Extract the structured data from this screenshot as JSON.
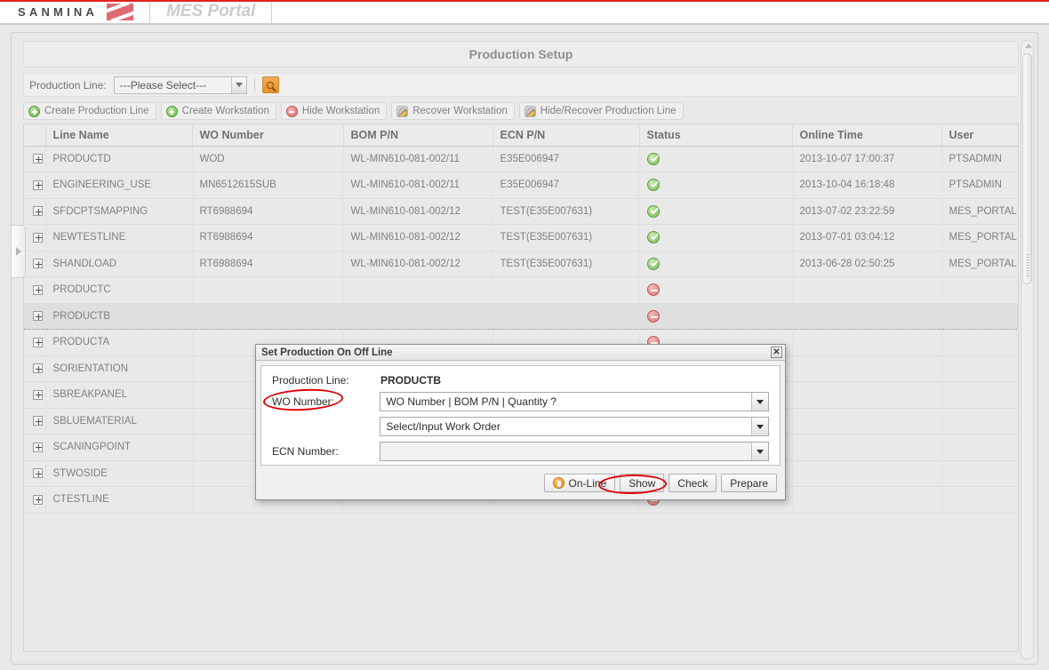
{
  "brand": {
    "company": "SANMINA",
    "product": "MES Portal",
    "logo_color": "#e06a72",
    "accent_red": "#e2231a"
  },
  "page": {
    "title": "Production Setup"
  },
  "filter_bar": {
    "production_line_label": "Production Line:",
    "production_line_value": "---Please Select---",
    "search_icon": "search-icon"
  },
  "actions": [
    {
      "label": "Create Production Line",
      "icon": "plus-circle-green-icon"
    },
    {
      "label": "Create Workstation",
      "icon": "plus-circle-green-icon"
    },
    {
      "label": "Hide Workstation",
      "icon": "minus-circle-red-icon"
    },
    {
      "label": "Recover Workstation",
      "icon": "gear-pencil-icon"
    },
    {
      "label": "Hide/Recover Production Line",
      "icon": "gear-pencil-icon"
    }
  ],
  "grid": {
    "columns": [
      "Line Name",
      "WO Number",
      "BOM P/N",
      "ECN P/N",
      "Status",
      "Online Time",
      "User"
    ],
    "rows": [
      {
        "line": "PRODUCTD",
        "wo": "WOD",
        "bom": "WL-MIN610-081-002/11",
        "ecn": "E35E006947",
        "status": "online",
        "time": "2013-10-07 17:00:37",
        "user": "PTSADMIN",
        "selected": false
      },
      {
        "line": "ENGINEERING_USE",
        "wo": "MN6512615SUB",
        "bom": "WL-MIN610-081-002/11",
        "ecn": "E35E006947",
        "status": "online",
        "time": "2013-10-04 16:18:48",
        "user": "PTSADMIN",
        "selected": false
      },
      {
        "line": "SFDCPTSMAPPING",
        "wo": "RT6988694",
        "bom": "WL-MIN610-081-002/12",
        "ecn": "TEST(E35E007631)",
        "status": "online",
        "time": "2013-07-02 23:22:59",
        "user": "MES_PORTAL",
        "selected": false
      },
      {
        "line": "NEWTESTLINE",
        "wo": "RT6988694",
        "bom": "WL-MIN610-081-002/12",
        "ecn": "TEST(E35E007631)",
        "status": "online",
        "time": "2013-07-01 03:04:12",
        "user": "MES_PORTAL",
        "selected": false
      },
      {
        "line": "SHANDLOAD",
        "wo": "RT6988694",
        "bom": "WL-MIN610-081-002/12",
        "ecn": "TEST(E35E007631)",
        "status": "online",
        "time": "2013-06-28 02:50:25",
        "user": "MES_PORTAL",
        "selected": false
      },
      {
        "line": "PRODUCTC",
        "wo": "",
        "bom": "",
        "ecn": "",
        "status": "offline",
        "time": "",
        "user": "",
        "selected": false
      },
      {
        "line": "PRODUCTB",
        "wo": "",
        "bom": "",
        "ecn": "",
        "status": "offline",
        "time": "",
        "user": "",
        "selected": true
      },
      {
        "line": "PRODUCTA",
        "wo": "",
        "bom": "",
        "ecn": "",
        "status": "offline",
        "time": "",
        "user": "",
        "selected": false
      },
      {
        "line": "SORIENTATION",
        "wo": "",
        "bom": "",
        "ecn": "",
        "status": "offline",
        "time": "",
        "user": "",
        "selected": false
      },
      {
        "line": "SBREAKPANEL",
        "wo": "",
        "bom": "",
        "ecn": "",
        "status": "offline",
        "time": "",
        "user": "",
        "selected": false
      },
      {
        "line": "SBLUEMATERIAL",
        "wo": "",
        "bom": "",
        "ecn": "",
        "status": "offline",
        "time": "",
        "user": "",
        "selected": false
      },
      {
        "line": "SCANINGPOINT",
        "wo": "",
        "bom": "",
        "ecn": "",
        "status": "offline",
        "time": "",
        "user": "",
        "selected": false
      },
      {
        "line": "STWOSIDE",
        "wo": "",
        "bom": "",
        "ecn": "",
        "status": "offline",
        "time": "",
        "user": "",
        "selected": false
      },
      {
        "line": "CTESTLINE",
        "wo": "",
        "bom": "",
        "ecn": "",
        "status": "offline",
        "time": "",
        "user": "",
        "selected": false
      }
    ]
  },
  "dialog": {
    "title": "Set Production On Off Line",
    "close_label": "✕",
    "production_line_label": "Production Line:",
    "production_line_value": "PRODUCTB",
    "wo_number_label": "WO Number:",
    "wo_select_value": "WO Number | BOM P/N | Quantity ?",
    "wo_input_value": "Select/Input Work Order",
    "ecn_number_label": "ECN Number:",
    "ecn_select_value": "",
    "buttons": [
      {
        "label": "On-Line",
        "icon": "online-orange-icon"
      },
      {
        "label": "Show",
        "icon": ""
      },
      {
        "label": "Check",
        "icon": ""
      },
      {
        "label": "Prepare",
        "icon": ""
      }
    ]
  },
  "annotations": {
    "color": "#e00000",
    "marks": [
      "wo-number-label",
      "on-line-button"
    ]
  }
}
